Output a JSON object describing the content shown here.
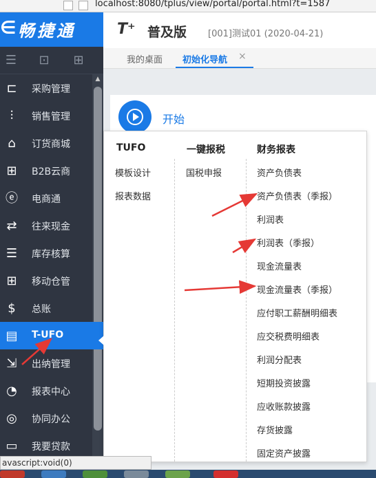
{
  "browser": {
    "url": "localhost:8080/tplus/view/portal/portal.html?t=1587"
  },
  "logo": {
    "mark": "∈",
    "name": "畅捷通"
  },
  "header": {
    "brand": "T⁺",
    "edition": "普及版",
    "account": "[001]测试01   (2020-04-21)"
  },
  "tabs": [
    {
      "label": "我的桌面"
    },
    {
      "label": "初始化导航"
    }
  ],
  "tab_close": "×",
  "sidebar": {
    "tools": [
      "☰",
      "⊡",
      "⊞"
    ],
    "scroll_up": "▲",
    "items": [
      {
        "label": "采购管理",
        "icon": "cart-icon",
        "glyph": "⊏"
      },
      {
        "label": "销售管理",
        "icon": "chart-up-icon",
        "glyph": "⫶"
      },
      {
        "label": "订货商城",
        "icon": "store-icon",
        "glyph": "⌂"
      },
      {
        "label": "B2B云商",
        "icon": "grid-icon",
        "glyph": "⊞"
      },
      {
        "label": "电商通",
        "icon": "e-commerce-icon",
        "glyph": "ⓔ"
      },
      {
        "label": "往来现金",
        "icon": "exchange-icon",
        "glyph": "⇄"
      },
      {
        "label": "库存核算",
        "icon": "warehouse-icon",
        "glyph": "☰"
      },
      {
        "label": "移动仓管",
        "icon": "mobile-grid-icon",
        "glyph": "⊞"
      },
      {
        "label": "总账",
        "icon": "ledger-icon",
        "glyph": "$"
      },
      {
        "label": "T-UFO",
        "icon": "ufo-icon",
        "glyph": "▤"
      },
      {
        "label": "出纳管理",
        "icon": "cashier-icon",
        "glyph": "⇲"
      },
      {
        "label": "报表中心",
        "icon": "pie-chart-icon",
        "glyph": "◔"
      },
      {
        "label": "协同办公",
        "icon": "collab-icon",
        "glyph": "◎"
      },
      {
        "label": "我要贷款",
        "icon": "loan-icon",
        "glyph": "▭"
      }
    ]
  },
  "start": {
    "label": "开始"
  },
  "menu": {
    "columns": [
      {
        "heading": "TUFO",
        "items": [
          "模板设计",
          "报表数据"
        ]
      },
      {
        "heading": "一键报税",
        "items": [
          "国税申报"
        ]
      },
      {
        "heading": "财务报表",
        "items": [
          "资产负债表",
          "资产负债表（季报）",
          "利润表",
          "利润表（季报）",
          "现金流量表",
          "现金流量表（季报）",
          "应付职工薪酬明细表",
          "应交税费明细表",
          "利润分配表",
          "短期投资披露",
          "应收账款披露",
          "存货披露",
          "固定资产披露"
        ]
      }
    ]
  },
  "status_bar": {
    "text": "avascript:void(0)"
  },
  "colors": {
    "primary": "#1a7ae6",
    "sidebar": "#2f3541",
    "annotation": "#e53935"
  }
}
